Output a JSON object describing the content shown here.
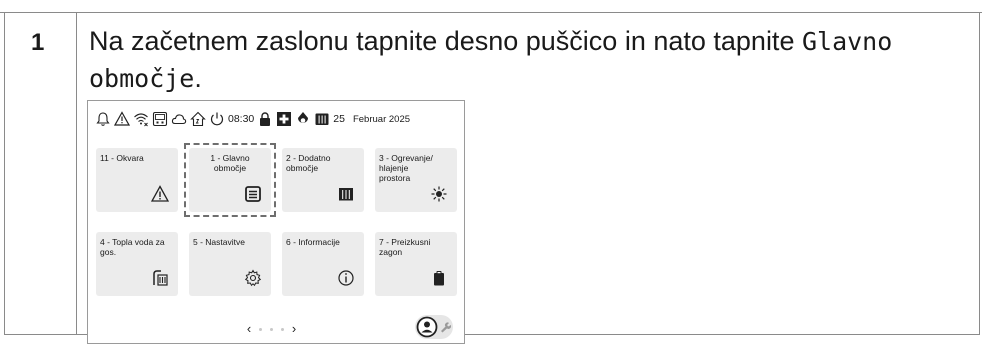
{
  "step": {
    "number": "1",
    "text_before": "Na začetnem zaslonu tapnite desno puščico in nato tapnite ",
    "code_part1": "Glavno",
    "code_part2": "območje",
    "text_after": "."
  },
  "statusbar": {
    "icons": [
      "bell-icon",
      "warning-icon",
      "wifi-icon",
      "controller-icon",
      "cloud-icon",
      "home-icon",
      "power-icon",
      "lock-icon",
      "first-aid-icon",
      "drop-icon",
      "radiator-icon"
    ],
    "time": "08:30",
    "day": "25",
    "date": "Februar 2025"
  },
  "tiles": [
    {
      "label": "11 - Okvara",
      "icon": "warning-icon"
    },
    {
      "label": "1 - Glavno\nobmočje",
      "icon": "heat-pump-icon",
      "highlighted": true
    },
    {
      "label": "2 - Dodatno\nobmočje",
      "icon": "radiator-icon"
    },
    {
      "label": "3 - Ogrevanje/\nhlajenje\nprostora",
      "icon": "sun-snow-icon"
    },
    {
      "label": "4 - Topla voda za\ngos.",
      "icon": "shower-icon"
    },
    {
      "label": "5 - Nastavitve",
      "icon": "gear-icon"
    },
    {
      "label": "6 - Informacije",
      "icon": "info-icon"
    },
    {
      "label": "7 - Preizkusni\nzagon",
      "icon": "clipboard-icon"
    }
  ],
  "pager": {
    "prev": "‹",
    "next": "›",
    "pages": 3,
    "current": 2
  },
  "colors": {
    "tile_bg": "#ececec",
    "border": "#8a8a8a",
    "highlight_dash": "#6e6e6e"
  }
}
